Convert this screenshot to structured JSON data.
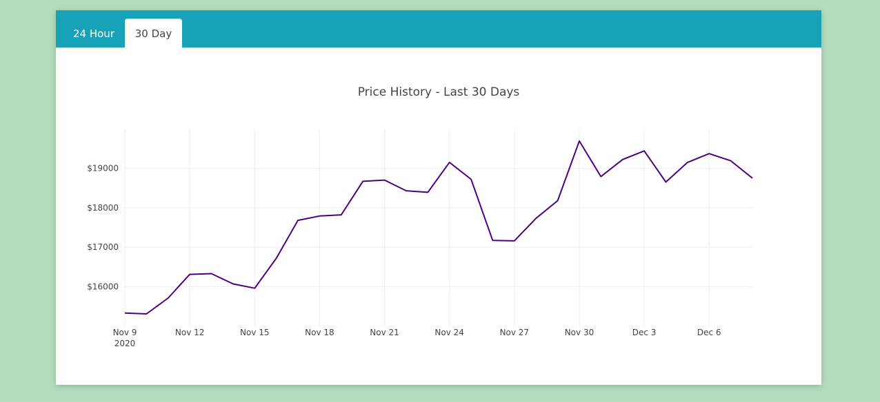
{
  "tabs": [
    {
      "label": "24 Hour",
      "active": false
    },
    {
      "label": "30 Day",
      "active": true
    }
  ],
  "colors": {
    "page_background": "#b3dcbe",
    "tab_bar": "#18a2b8",
    "line": "#4b0082",
    "grid": "#eeeeee"
  },
  "chart_data": {
    "type": "line",
    "title": "Price History - Last 30 Days",
    "xlabel": "",
    "ylabel": "",
    "grid": true,
    "legend": "none",
    "x": [
      "2020-11-09",
      "2020-11-10",
      "2020-11-11",
      "2020-11-12",
      "2020-11-13",
      "2020-11-14",
      "2020-11-15",
      "2020-11-16",
      "2020-11-17",
      "2020-11-18",
      "2020-11-19",
      "2020-11-20",
      "2020-11-21",
      "2020-11-22",
      "2020-11-23",
      "2020-11-24",
      "2020-11-25",
      "2020-11-26",
      "2020-11-27",
      "2020-11-28",
      "2020-11-29",
      "2020-11-30",
      "2020-12-01",
      "2020-12-02",
      "2020-12-03",
      "2020-12-04",
      "2020-12-05",
      "2020-12-06",
      "2020-12-07",
      "2020-12-08"
    ],
    "series": [
      {
        "values": [
          15330,
          15310,
          15710,
          16310,
          16330,
          16070,
          15960,
          16720,
          17680,
          17790,
          17820,
          18670,
          18700,
          18430,
          18390,
          19150,
          18720,
          17170,
          17160,
          17730,
          18180,
          19690,
          18790,
          19220,
          19440,
          18650,
          19150,
          19370,
          19190,
          18750
        ]
      }
    ],
    "xlim": [
      "2020-11-09",
      "2020-12-08"
    ],
    "ylim": [
      15100,
      19950
    ],
    "x_ticks": [
      {
        "date": "2020-11-09",
        "label": "Nov 9",
        "sublabel": "2020"
      },
      {
        "date": "2020-11-12",
        "label": "Nov 12"
      },
      {
        "date": "2020-11-15",
        "label": "Nov 15"
      },
      {
        "date": "2020-11-18",
        "label": "Nov 18"
      },
      {
        "date": "2020-11-21",
        "label": "Nov 21"
      },
      {
        "date": "2020-11-24",
        "label": "Nov 24"
      },
      {
        "date": "2020-11-27",
        "label": "Nov 27"
      },
      {
        "date": "2020-11-30",
        "label": "Nov 30"
      },
      {
        "date": "2020-12-03",
        "label": "Dec 3"
      },
      {
        "date": "2020-12-06",
        "label": "Dec 6"
      }
    ],
    "y_ticks": [
      {
        "value": 16000,
        "label": "$16000"
      },
      {
        "value": 17000,
        "label": "$17000"
      },
      {
        "value": 18000,
        "label": "$18000"
      },
      {
        "value": 19000,
        "label": "$19000"
      }
    ]
  }
}
